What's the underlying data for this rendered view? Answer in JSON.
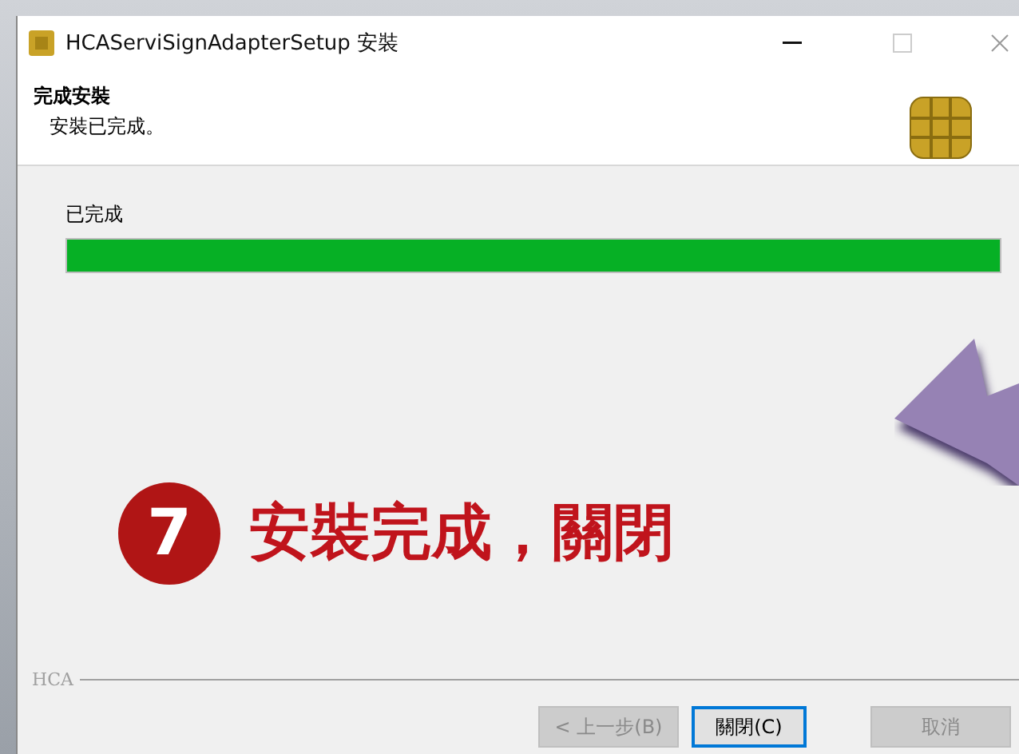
{
  "window": {
    "title": "HCAServiSignAdapterSetup 安裝"
  },
  "header": {
    "title": "完成安裝",
    "subtitle": "安裝已完成。"
  },
  "progress": {
    "label": "已完成",
    "level": 1
  },
  "footer": {
    "brand": "HCA"
  },
  "buttons": [
    {
      "label": "< 上一步(B)",
      "disabled": true,
      "default": false
    },
    {
      "label": "關閉(C)",
      "disabled": false,
      "default": true
    },
    {
      "label": "取消",
      "disabled": true,
      "default": false
    }
  ],
  "annotation": {
    "step": "7",
    "text": "安裝完成，關閉"
  }
}
